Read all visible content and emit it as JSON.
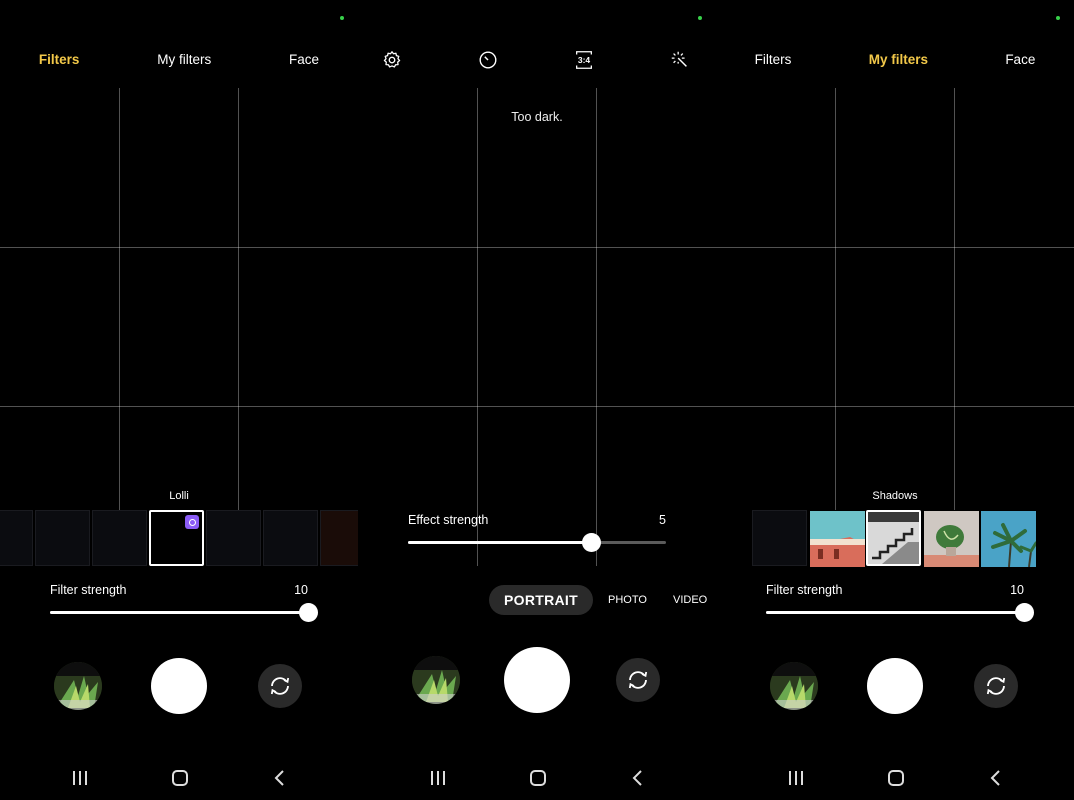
{
  "left": {
    "tabs": [
      "Filters",
      "My filters",
      "Face"
    ],
    "active_tab": 0,
    "filter_name": "Lolli",
    "selected_thumb": 3,
    "slider": {
      "label": "Filter strength",
      "value": "10",
      "fraction": 1.0
    }
  },
  "middle": {
    "icons": [
      "settings-icon",
      "timer-icon",
      "aspect-ratio-icon",
      "effects-wand-icon"
    ],
    "aspect_ratio": "3:4",
    "hint": "Too dark.",
    "slider": {
      "label": "Effect strength",
      "value": "5",
      "fraction": 0.71
    },
    "modes": [
      "PORTRAIT",
      "PHOTO",
      "VIDEO"
    ],
    "active_mode": "PORTRAIT"
  },
  "right": {
    "tabs": [
      "Filters",
      "My filters",
      "Face"
    ],
    "active_tab": 1,
    "filter_name": "Shadows",
    "selected_thumb": 2,
    "slider": {
      "label": "Filter strength",
      "value": "10",
      "fraction": 1.0
    }
  },
  "colors": {
    "active_tab": "#f2c849",
    "status_dot": "#37d14a",
    "badge": "#8b5cf6"
  },
  "nav": [
    "recent-apps-icon",
    "home-icon",
    "back-icon"
  ]
}
